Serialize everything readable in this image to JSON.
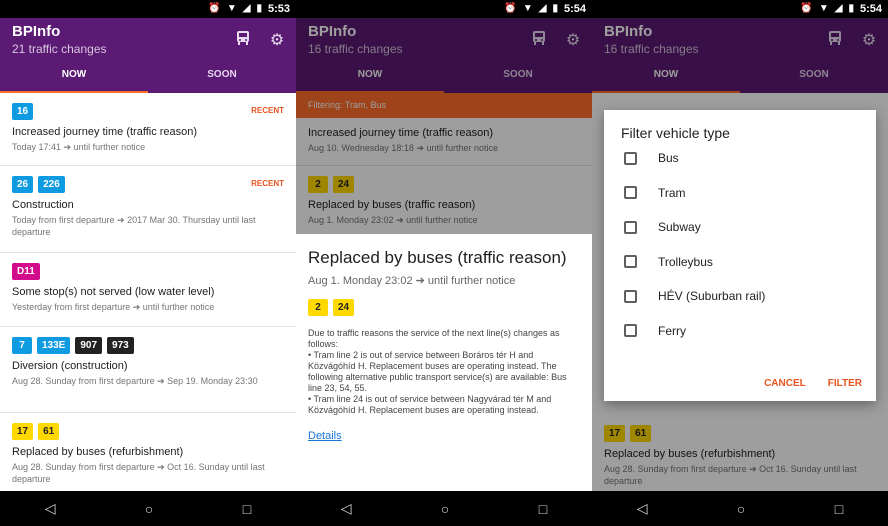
{
  "status": {
    "time1": "5:53",
    "time2": "5:54",
    "time3": "5:54"
  },
  "app": {
    "title": "BPInfo",
    "subtitle1": "21 traffic changes",
    "subtitle2": "16 traffic changes",
    "subtitle3": "16 traffic changes",
    "tabs": [
      "NOW",
      "SOON"
    ],
    "icons": [
      "bus-icon",
      "gear-icon"
    ]
  },
  "screen1": {
    "items": [
      {
        "badges": [
          "16"
        ],
        "recent": "RECENT",
        "title": "Increased journey time (traffic reason)",
        "date": "Today 17:41 ➔  until further notice"
      },
      {
        "badges": [
          "26",
          "226"
        ],
        "recent": "RECENT",
        "title": "Construction",
        "date": "Today from first departure ➔ 2017 Mar 30. Thursday until last departure"
      },
      {
        "badges": [
          "D11"
        ],
        "recent": "",
        "title": "Some stop(s) not served (low water level)",
        "date": "Yesterday from first departure ➔  until further notice"
      },
      {
        "badges": [
          "7",
          "133E",
          "907",
          "973"
        ],
        "recent": "",
        "title": "Diversion (construction)",
        "date": "Aug 28. Sunday from first departure ➔ Sep 19. Monday 23:30"
      },
      {
        "badges": [
          "17",
          "61"
        ],
        "recent": "",
        "title": "Replaced by buses (refurbishment)",
        "date": "Aug 28. Sunday from first departure ➔ Oct 16. Sunday until last departure"
      }
    ]
  },
  "screen2": {
    "filter": "Filtering: Tram, Bus",
    "items": [
      {
        "title": "Increased journey time (traffic reason)",
        "date": "Aug 10. Wednesday 18:18 ➔  until further notice"
      },
      {
        "badges": [
          "2",
          "24"
        ],
        "title": "Replaced by buses (traffic reason)",
        "date": "Aug 1. Monday 23:02 ➔  until further notice"
      }
    ],
    "sheet": {
      "title": "Replaced by buses (traffic reason)",
      "date": "Aug 1. Monday 23:02 ➔  until further notice",
      "badges": [
        "2",
        "24"
      ],
      "intro": "Due to traffic reasons the service of the next line(s) changes as follows:",
      "bullet1": "• Tram line 2 is out of service between Boráros tér H and Közvágóhíd H. Replacement buses are operating instead. The following alternative public transport service(s) are available: Bus line 23, 54, 55.",
      "bullet2": "• Tram line 24 is out of service between Nagyvárad tér M and Közvágóhíd H. Replacement buses are operating instead.",
      "details": "Details"
    }
  },
  "screen3": {
    "dialog": {
      "title": "Filter vehicle type",
      "options": [
        "Bus",
        "Tram",
        "Subway",
        "Trolleybus",
        "HÉV (Suburban rail)",
        "Ferry"
      ],
      "cancel": "CANCEL",
      "filter": "FILTER"
    },
    "bg_item": {
      "badges": [
        "17",
        "61"
      ],
      "title": "Replaced by buses (refurbishment)",
      "date": "Aug 28. Sunday from first departure ➔ Oct 16. Sunday until last departure"
    }
  },
  "colors": {
    "appbar": "#5b1a73",
    "accent": "#ff6d2a",
    "recent": "#e8541e",
    "badge_blue": "#0e9be1",
    "badge_yellow": "#ffd800",
    "badge_magenta": "#d20c8c",
    "badge_black": "#222222"
  }
}
